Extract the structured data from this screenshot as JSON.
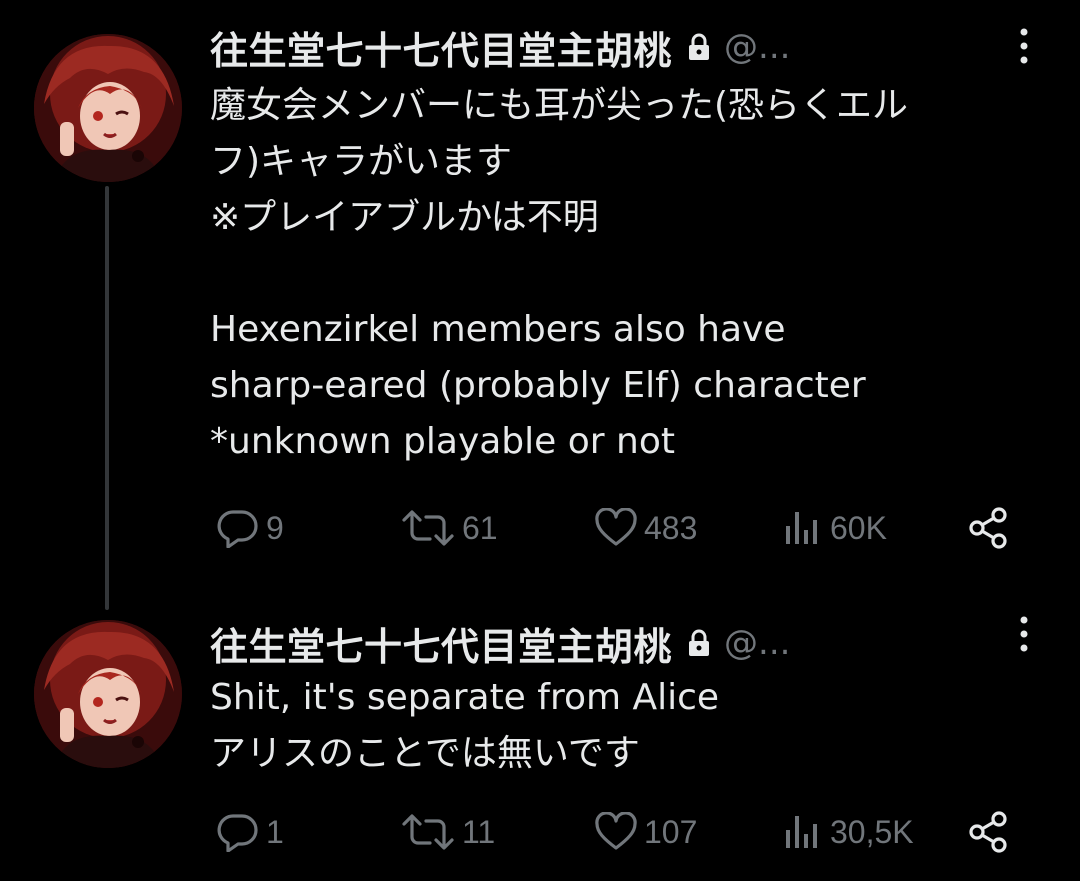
{
  "colors": {
    "background": "#000000",
    "text_primary": "#e7e9ea",
    "text_secondary": "#71767b",
    "thread_line": "#333639"
  },
  "tweets": [
    {
      "author": {
        "display_name": "往生堂七十七代目堂主胡桃",
        "handle": "@...",
        "protected_icon": "lock-icon",
        "avatar": "avatar"
      },
      "text": "魔女会メンバーにも耳が尖った(恐らくエル\nフ)キャラがいます\n※プレイアブルかは不明\n\nHexenzirkel members also have\nsharp-eared (probably Elf) character\n*unknown playable or not",
      "actions": {
        "replies": "9",
        "retweets": "61",
        "likes": "483",
        "views": "60K"
      }
    },
    {
      "author": {
        "display_name": "往生堂七十七代目堂主胡桃",
        "handle": "@...",
        "protected_icon": "lock-icon",
        "avatar": "avatar"
      },
      "text": "Shit, it's separate from Alice\nアリスのことでは無いです",
      "actions": {
        "replies": "1",
        "retweets": "11",
        "likes": "107",
        "views": "30,5K"
      }
    }
  ]
}
